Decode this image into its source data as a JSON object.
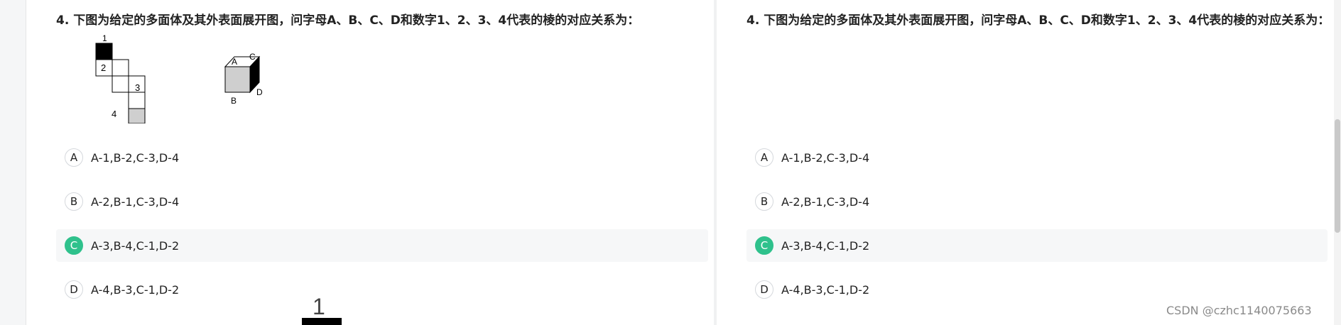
{
  "question": {
    "title": "4. 下图为给定的多面体及其外表面展开图，问字母A、B、C、D和数字1、2、3、4代表的棱的对应关系为："
  },
  "figure": {
    "net_labels": [
      "1",
      "2",
      "3",
      "4"
    ],
    "cube_labels": [
      "A",
      "C",
      "B",
      "D"
    ]
  },
  "options": [
    {
      "letter": "A",
      "text": "A-1,B-2,C-3,D-4"
    },
    {
      "letter": "B",
      "text": "A-2,B-1,C-3,D-4"
    },
    {
      "letter": "C",
      "text": "A-3,B-4,C-1,D-2"
    },
    {
      "letter": "D",
      "text": "A-4,B-3,C-1,D-2"
    }
  ],
  "selected_option": "C",
  "cropped_label": "1",
  "watermark": "CSDN @czhc1140075663",
  "colors": {
    "selected_badge": "#2fc18c",
    "selected_row_bg": "#f6f7f8"
  }
}
